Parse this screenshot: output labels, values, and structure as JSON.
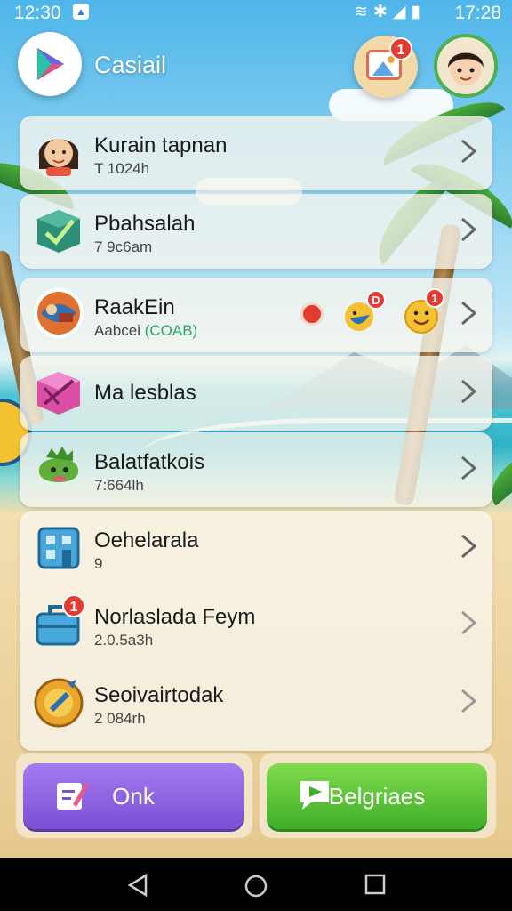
{
  "status_bar": {
    "time_left": "12:30",
    "time_right": "17:28",
    "app_chip_icon": "app-notification-icon",
    "system_icons": [
      "wifi-icon",
      "bluetooth-icon",
      "signal-icon",
      "battery-icon"
    ]
  },
  "header": {
    "app_name": "Casiail",
    "logo_icon": "play-logo-icon",
    "gallery_icon": "gallery-icon",
    "gallery_badge": "1",
    "avatar_icon": "profile-avatar-icon"
  },
  "list": [
    {
      "icon": "avatar-girl-icon",
      "title": "Kurain tapnan",
      "subtitle": "T 1024h"
    },
    {
      "icon": "green-box-icon",
      "title": "Pbahsalah",
      "subtitle": "7 9c6am"
    },
    {
      "icon": "game-art-icon",
      "title": "RaakEin",
      "subtitle_prefix": "Aabcei",
      "subtitle_tag": "(COAB)",
      "extras": [
        "red-dot-icon",
        "emoji-badge-icon",
        "smiley-badge-icon"
      ],
      "extra_badges": [
        "D",
        "1"
      ]
    },
    {
      "icon": "pink-box-icon",
      "title": "Ma lesblas",
      "subtitle": ""
    },
    {
      "icon": "green-creature-icon",
      "title": "Balatfatkois",
      "subtitle": "7:664lh"
    },
    {
      "icon": "blue-building-icon",
      "title": "Oehelarala",
      "subtitle": "9"
    },
    {
      "icon": "briefcase-icon",
      "title": "Norlaslada Feym",
      "subtitle": "2.0.5a3h",
      "badge": "1"
    },
    {
      "icon": "gold-medal-icon",
      "title": "Seoivairtodak",
      "subtitle": "2 084rh"
    }
  ],
  "buttons": {
    "left_label": "Onk",
    "left_icon": "edit-note-icon",
    "right_label": "Belgriaes",
    "right_icon": "play-message-icon"
  },
  "nav": [
    "back-icon",
    "home-icon",
    "recents-icon"
  ],
  "colors": {
    "purple_button": "#8a5ee0",
    "green_button": "#52c236",
    "badge_red": "#e33b2f",
    "avatar_ring": "#4caf50"
  }
}
